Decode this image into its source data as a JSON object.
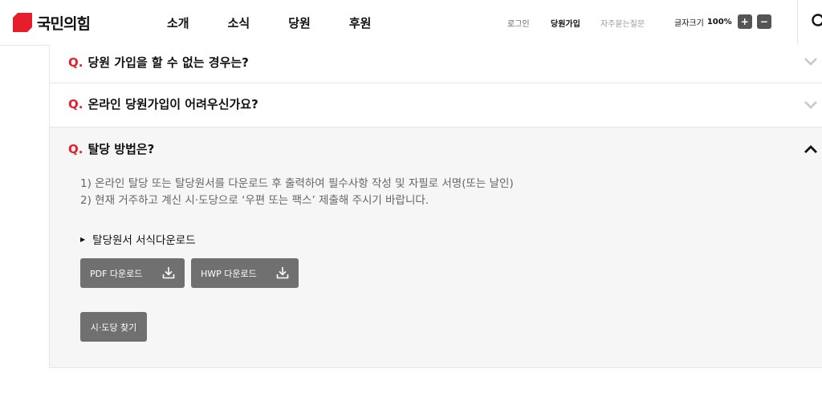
{
  "header": {
    "logo_text": "국민의힘",
    "nav": [
      "소개",
      "소식",
      "당원",
      "후원"
    ],
    "login": "로그인",
    "join": "당원가입",
    "faq": "자주묻는질문",
    "font_size_label": "글자크기",
    "font_size_value": "100%",
    "font_plus": "+",
    "font_minus": "−"
  },
  "faq": {
    "q_mark": "Q.",
    "items": [
      {
        "question": "당원 가입을 할 수 없는 경우는?",
        "expanded": false
      },
      {
        "question": "온라인 당원가입이 어려우신가요?",
        "expanded": false
      },
      {
        "question": "탈당 방법은?",
        "expanded": true
      }
    ],
    "answer_lines": [
      "1) 온라인 탈당 또는 탈당원서를 다운로드 후 출력하여 필수사항 작성 및 자필로 서명(또는 날인)",
      "2) 현재 거주하고 계신 시·도당으로 ‘우편 또는 팩스’ 제출해 주시기 바랍니다."
    ],
    "download_title": "탈당원서 서식다운로드",
    "pdf_button": "PDF 다운로드",
    "hwp_button": "HWP 다운로드",
    "region_button": "시·도당 찾기"
  },
  "colors": {
    "accent": "#e61e2b",
    "button_bg": "#707070",
    "open_bg": "#f6f6f6"
  }
}
